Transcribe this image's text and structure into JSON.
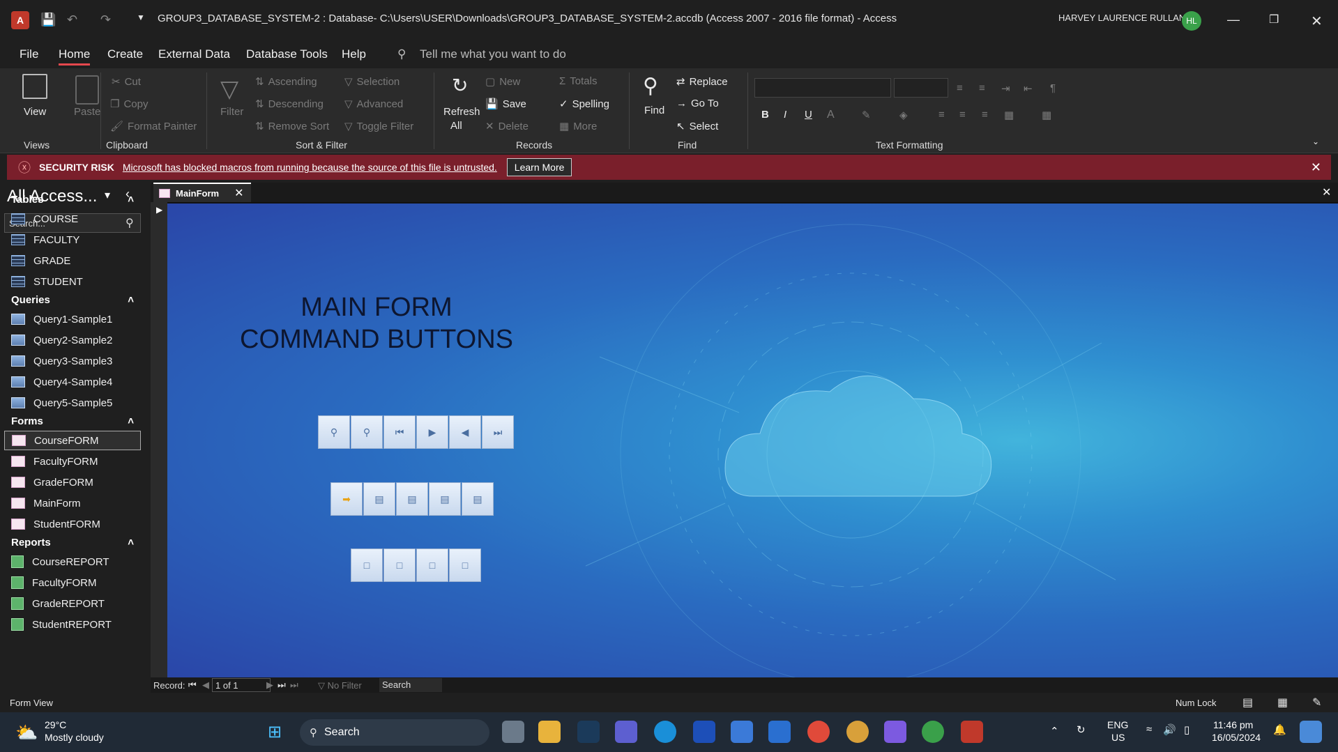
{
  "titlebar": {
    "title": "GROUP3_DATABASE_SYSTEM-2 : Database- C:\\Users\\USER\\Downloads\\GROUP3_DATABASE_SYSTEM-2.accdb (Access 2007 - 2016 file format)  -  Access",
    "user": "HARVEY LAURENCE RULLAN",
    "initials": "HL"
  },
  "menu": [
    "File",
    "Home",
    "Create",
    "External Data",
    "Database Tools",
    "Help"
  ],
  "tellme": "Tell me what you want to do",
  "ribbon": {
    "views": {
      "view": "View",
      "group": "Views"
    },
    "clipboard": {
      "paste": "Paste",
      "cut": "Cut",
      "copy": "Copy",
      "format_painter": "Format Painter",
      "group": "Clipboard"
    },
    "sort": {
      "filter": "Filter",
      "ascending": "Ascending",
      "descending": "Descending",
      "remove_sort": "Remove Sort",
      "selection": "Selection",
      "advanced": "Advanced",
      "toggle_filter": "Toggle Filter",
      "group": "Sort & Filter"
    },
    "records": {
      "refresh": "Refresh",
      "all": "All",
      "new": "New",
      "save": "Save",
      "delete": "Delete",
      "totals": "Totals",
      "spelling": "Spelling",
      "more": "More",
      "group": "Records"
    },
    "find": {
      "find": "Find",
      "replace": "Replace",
      "goto": "Go To",
      "select": "Select",
      "group": "Find"
    },
    "text": {
      "group": "Text Formatting",
      "bold": "B",
      "italic": "I",
      "underline": "U"
    }
  },
  "security": {
    "label": "SECURITY RISK",
    "message": "Microsoft has blocked macros from running because the source of this file is untrusted.",
    "button": "Learn More"
  },
  "nav": {
    "title": "All Access...",
    "search_placeholder": "Search...",
    "tables_header": "Tables",
    "tables": [
      "COURSE",
      "FACULTY",
      "GRADE",
      "STUDENT"
    ],
    "queries_header": "Queries",
    "queries": [
      "Query1-Sample1",
      "Query2-Sample2",
      "Query3-Sample3",
      "Query4-Sample4",
      "Query5-Sample5"
    ],
    "forms_header": "Forms",
    "forms": [
      "CourseFORM",
      "FacultyFORM",
      "GradeFORM",
      "MainForm",
      "StudentFORM"
    ],
    "reports_header": "Reports",
    "reports": [
      "CourseREPORT",
      "FacultyFORM",
      "GradeREPORT",
      "StudentREPORT"
    ]
  },
  "doc_tab": "MainForm",
  "form": {
    "title_line1": "MAIN FORM",
    "title_line2": "COMMAND BUTTONS"
  },
  "recnav": {
    "label": "Record:",
    "position": "1 of 1",
    "filter": "No Filter",
    "search": "Search"
  },
  "status": {
    "left": "Form View",
    "numlock": "Num Lock"
  },
  "taskbar": {
    "temp": "29°C",
    "weather": "Mostly cloudy",
    "search": "Search",
    "lang1": "ENG",
    "lang2": "US",
    "time": "11:46 pm",
    "date": "16/05/2024"
  }
}
